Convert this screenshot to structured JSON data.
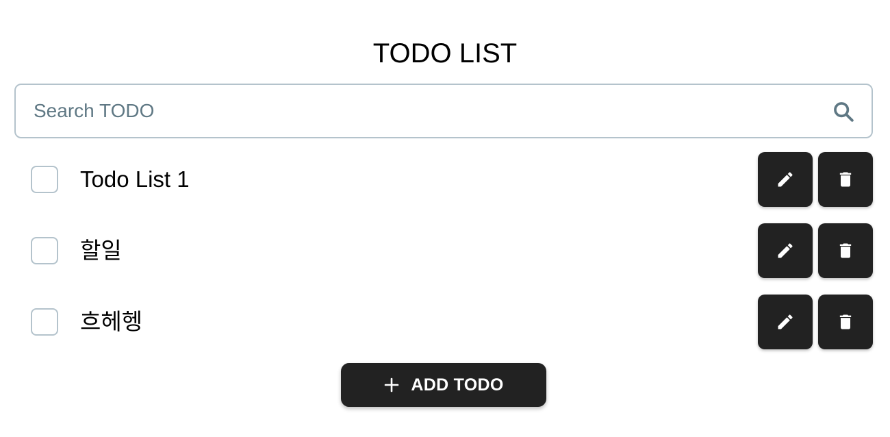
{
  "header": {
    "title": "TODO LIST"
  },
  "search": {
    "placeholder": "Search TODO",
    "value": "",
    "icon": "search-icon"
  },
  "todos": [
    {
      "text": "Todo List 1",
      "checked": false
    },
    {
      "text": "할일",
      "checked": false
    },
    {
      "text": "흐헤헹",
      "checked": false
    }
  ],
  "actions": {
    "edit_icon": "pencil-icon",
    "delete_icon": "trash-icon"
  },
  "add_button": {
    "label": "ADD TODO",
    "icon": "plus-icon"
  },
  "colors": {
    "button_bg": "#222222",
    "border": "#b4c3cc",
    "placeholder": "#5f7884"
  }
}
